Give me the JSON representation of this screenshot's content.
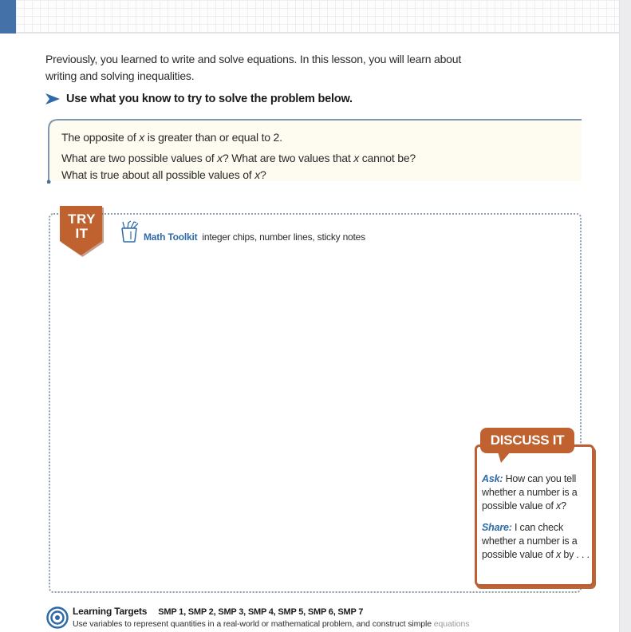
{
  "header": {
    "accent_color": "#4471a8"
  },
  "intro": {
    "text_line1": "Previously, you learned to write and solve equations. In this lesson, you will learn about",
    "text_line2": "writing and solving inequalities."
  },
  "instruction": {
    "icon": "arrow-right-icon",
    "text": "Use what you know to try to solve the problem below."
  },
  "problem": {
    "line1_pre": "The opposite of ",
    "line1_var": "x",
    "line1_post": " is greater than or equal to 2.",
    "line2_pre": "What are two possible values of ",
    "line2_var1": "x",
    "line2_mid": "? What are two values that ",
    "line2_var2": "x",
    "line2_post": " cannot be?",
    "line3_pre": "What is true about all possible values of ",
    "line3_var": "x",
    "line3_post": "?"
  },
  "try_it": {
    "badge_line1": "TRY",
    "badge_line2": "IT",
    "badge_color": "#c0622f",
    "toolkit_icon": "pencil-cup-icon",
    "toolkit_title": "Math Toolkit",
    "toolkit_items": "integer chips, number lines, sticky notes"
  },
  "discuss_it": {
    "title": "DISCUSS IT",
    "color": "#c0622f",
    "ask_label": "Ask:",
    "ask_text_pre": " How can you tell whether a number is a possible value of ",
    "ask_var": "x",
    "ask_text_post": "?",
    "share_label": "Share:",
    "share_text_pre": " I can check whether a number is a possible value of ",
    "share_var": "x",
    "share_text_post": " by . . ."
  },
  "learning_targets": {
    "icon": "target-icon",
    "title": "Learning Targets",
    "standards": "SMP 1, SMP 2, SMP 3, SMP 4, SMP 5, SMP 6, SMP 7",
    "description": "Use variables to represent quantities in a real-world or mathematical problem, and construct simple ",
    "description_faded": "equations"
  }
}
